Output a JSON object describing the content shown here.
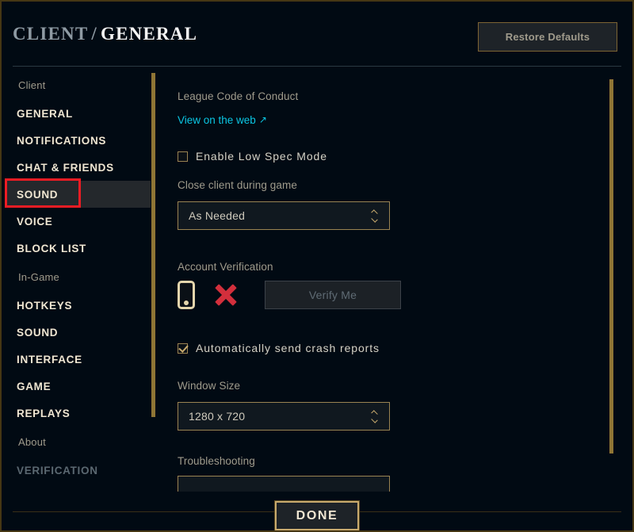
{
  "header": {
    "breadcrumb_parent": "CLIENT",
    "breadcrumb_separator": "/",
    "breadcrumb_current": "GENERAL",
    "restore_defaults_label": "Restore Defaults"
  },
  "sidebar": {
    "groups": [
      {
        "label": "Client",
        "items": [
          {
            "label": "GENERAL",
            "state": "active"
          },
          {
            "label": "NOTIFICATIONS",
            "state": "normal"
          },
          {
            "label": "CHAT & FRIENDS",
            "state": "normal"
          },
          {
            "label": "SOUND",
            "state": "hovered"
          },
          {
            "label": "VOICE",
            "state": "normal"
          },
          {
            "label": "BLOCK LIST",
            "state": "normal"
          }
        ]
      },
      {
        "label": "In-Game",
        "items": [
          {
            "label": "HOTKEYS",
            "state": "normal"
          },
          {
            "label": "SOUND",
            "state": "normal"
          },
          {
            "label": "INTERFACE",
            "state": "normal"
          },
          {
            "label": "GAME",
            "state": "normal"
          },
          {
            "label": "REPLAYS",
            "state": "normal"
          }
        ]
      },
      {
        "label": "About",
        "items": [
          {
            "label": "VERIFICATION",
            "state": "dim"
          }
        ]
      }
    ]
  },
  "content": {
    "code_of_conduct_label": "League Code of Conduct",
    "view_on_web_link": "View on the web",
    "external_link_icon": "↗",
    "low_spec_mode_label": "Enable Low Spec Mode",
    "low_spec_mode_checked": false,
    "close_client_label": "Close client during game",
    "close_client_value": "As Needed",
    "account_verification_label": "Account Verification",
    "verify_me_label": "Verify Me",
    "verify_me_enabled": false,
    "verification_status_icon": "red-x",
    "phone_icon": "mobile-phone-icon",
    "crash_reports_label": "Automatically send crash reports",
    "crash_reports_checked": true,
    "window_size_label": "Window Size",
    "window_size_value": "1280 x 720",
    "troubleshooting_label": "Troubleshooting",
    "troubleshooting_value": ""
  },
  "footer": {
    "done_label": "DONE"
  },
  "colors": {
    "background": "#010a13",
    "gold": "#c8aa6e",
    "gold_dark": "#7d6433",
    "text_primary": "#f0e6d2",
    "text_secondary": "#a09b8c",
    "link_cyan": "#0bc6e3",
    "highlight_red": "#ed1c24",
    "error_red": "#d32f3c"
  }
}
